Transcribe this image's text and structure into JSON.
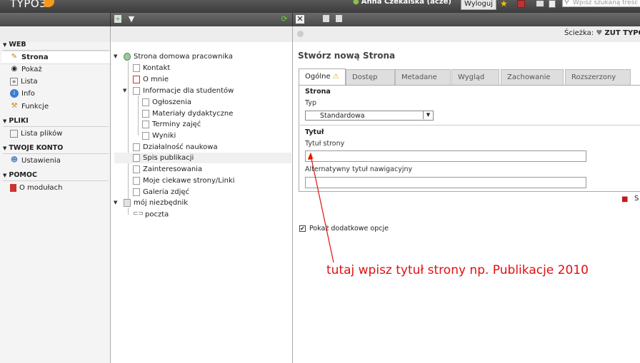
{
  "topbar": {
    "logo": "TYPO3",
    "user": "Anna Czekalska (acze)",
    "logout_label": "Wyloguj",
    "search_placeholder": "Wpisz szukaną treść"
  },
  "module_menu": {
    "sections": [
      {
        "title": "WEB",
        "items": [
          "Strona",
          "Pokaż",
          "Lista",
          "Info",
          "Funkcje"
        ]
      },
      {
        "title": "PLIKI",
        "items": [
          "Lista plików"
        ]
      },
      {
        "title": "TWOJE KONTO",
        "items": [
          "Ustawienia"
        ]
      },
      {
        "title": "POMOC",
        "items": [
          "O modułach"
        ]
      }
    ],
    "active_item": "Strona"
  },
  "page_tree": {
    "root": "Strona domowa pracownika",
    "nodes": [
      "Kontakt",
      "O mnie",
      "Informacje dla studentów",
      "Ogłoszenia",
      "Materiały dydaktyczne",
      "Terminy zajęć",
      "Wyniki",
      "Działalność naukowa",
      "Spis publikacji",
      "Zainteresowania",
      "Moje ciekawe strony/Linki",
      "Galeria zdjęć",
      "mój niezbędnik",
      "poczta"
    ]
  },
  "content": {
    "path_label": "Ścieżka:",
    "path_value": "ZUT TYPO",
    "page_title": "Stwórz nową Strona",
    "tabs": [
      "Ogólne",
      "Dostęp",
      "Metadane",
      "Wygląd",
      "Zachowanie",
      "Rozszerzony"
    ],
    "active_tab": "Ogólne",
    "section_strona": "Strona",
    "typ_label": "Typ",
    "typ_value": "Standardowa",
    "section_tytul": "Tytuł",
    "tytul_label": "Tytuł strony",
    "tytul_value": "",
    "alt_label": "Alternatywny tytuł nawigacyjny",
    "alt_value": "",
    "checkbox_label": "Pokaż dodatkowe opcje",
    "checkbox_checked": true,
    "save_letter": "S"
  },
  "annotation": {
    "text": "tutaj wpisz tytuł strony np. Publikacje 2010",
    "color": "#e01010"
  }
}
